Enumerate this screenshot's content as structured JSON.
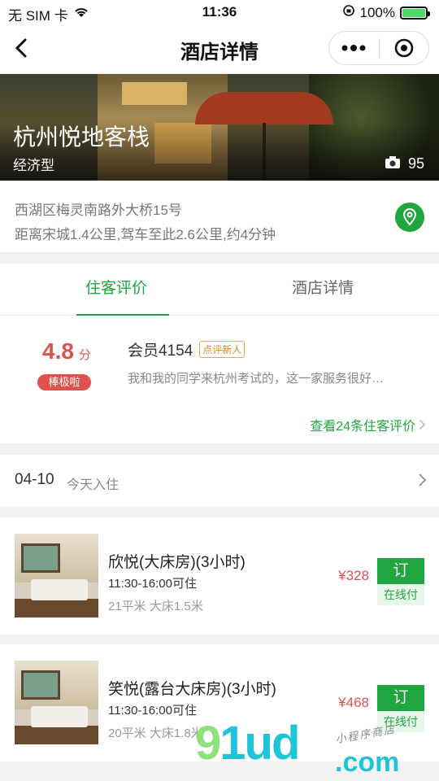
{
  "status_bar": {
    "carrier": "无 SIM 卡",
    "time": "11:36",
    "battery": "100%",
    "battery_level": 1.0
  },
  "nav": {
    "title": "酒店详情",
    "menu_icon": "more-dots-icon",
    "close_icon": "target-close-icon"
  },
  "hotel": {
    "name": "杭州悦地客栈",
    "type": "经济型",
    "photo_count": "95",
    "address": "西湖区梅灵南路外大桥15号",
    "distance": "距离宋城1.4公里,驾车至此2.6公里,约4分钟"
  },
  "tabs": [
    {
      "label": "住客评价",
      "active": true
    },
    {
      "label": "酒店详情",
      "active": false
    }
  ],
  "review": {
    "score": "4.8",
    "score_unit": "分",
    "badge": "棒极啦",
    "member": "会员4154",
    "member_tag": "点评新人",
    "comment": "我和我的同学来杭州考试的，这一家服务很好…",
    "more_link": "查看24条住客评价"
  },
  "date": {
    "value": "04-10",
    "note": "今天入住"
  },
  "rooms": [
    {
      "name": "欣悦(大床房)(3小时)",
      "time": "11:30-16:00可住",
      "info": "21平米  大床1.5米",
      "price": "¥328",
      "book_label": "订",
      "pay_label": "在线付"
    },
    {
      "name": "笑悦(露台大床房)(3小时)",
      "time": "11:30-16:00可住",
      "info": "20平米  大床1.8米",
      "price": "¥468",
      "book_label": "订",
      "pay_label": "在线付"
    }
  ],
  "watermark": {
    "big_g": "9",
    "big_l": "1ud",
    "com": ".com",
    "small": "小程序商店"
  },
  "colors": {
    "accent": "#1fa63e",
    "price": "#e0514e"
  }
}
